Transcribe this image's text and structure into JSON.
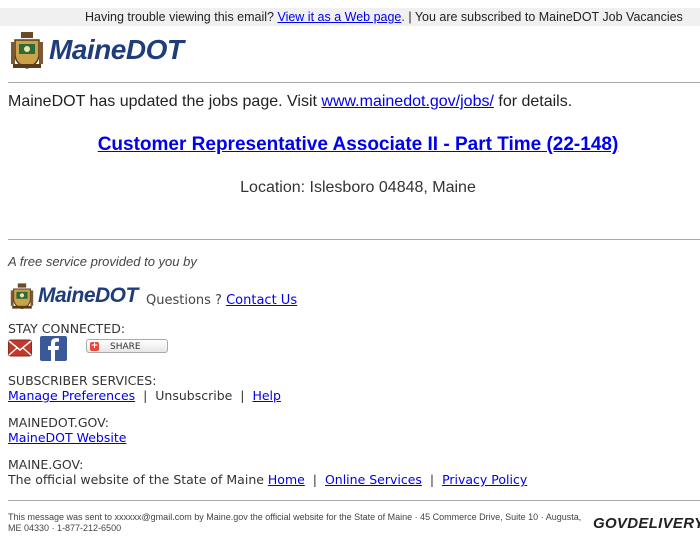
{
  "topbar": {
    "prefix": "Having trouble viewing this email? ",
    "web_link": "View it as a Web page",
    "suffix": ". | You are subscribed to MaineDOT Job Vacancies"
  },
  "header": {
    "logo_text": "MaineDOT"
  },
  "main": {
    "intro_prefix": "MaineDOT has updated the jobs page. Visit ",
    "intro_link": "www.mainedot.gov/jobs/",
    "intro_suffix": " for details.",
    "job_title": "Customer Representative Associate II - Part Time (22-148)",
    "location": "Location: Islesboro 04848, Maine"
  },
  "footer": {
    "free_service": "A free service provided to you by",
    "logo_text": "MaineDOT",
    "questions": "Questions ? ",
    "contact": "Contact Us",
    "stay_connected": "STAY CONNECTED:",
    "share_label": "SHARE",
    "subscriber_services": "SUBSCRIBER SERVICES:",
    "manage_prefs": "Manage Preferences",
    "sep1": "  |  ",
    "unsubscribe": "Unsubscribe",
    "sep2": "  |  ",
    "help": "Help",
    "mainedot_gov": "MAINEDOT.GOV:",
    "mainedot_website": "MaineDOT Website",
    "maine_gov": "MAINE.GOV:",
    "official": "The official website of the State of Maine ",
    "home": "Home",
    "sep3": "  |  ",
    "online_services": "Online Services",
    "sep4": "  |  ",
    "privacy": "Privacy Policy",
    "fine_print": "This message was sent to xxxxxx@gmail.com by Maine.gov the official website for the State of Maine · 45 Commerce Drive, Suite 10 · Augusta, ME 04330 · 1-877-212-6500",
    "govdelivery": "GOVDELIVERY"
  },
  "colors": {
    "link": "#0000ee",
    "brand": "#1f3d7a",
    "divider": "#a9a9a9",
    "facebook": "#3b5998",
    "email_icon": "#c0392b"
  }
}
